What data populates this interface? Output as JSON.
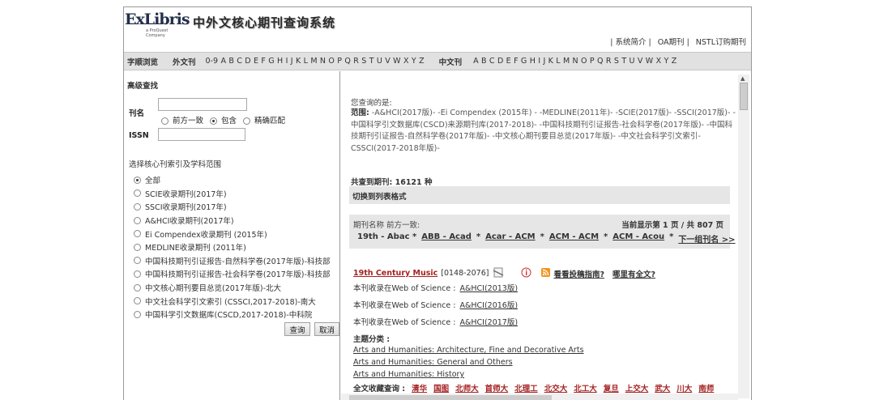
{
  "header": {
    "logo_text": "ExLibris",
    "logo_sub": "a ProQuest Company",
    "title": "中外文核心期刊查询系统",
    "links": [
      "| 系统简介 |",
      "OA期刊 |",
      "NSTL订购期刊"
    ]
  },
  "alpha_bar": {
    "browse_label": "字顺浏览",
    "foreign_label": "外文刊",
    "foreign_letters": [
      "0-9",
      "A",
      "B",
      "C",
      "D",
      "E",
      "F",
      "G",
      "H",
      "I",
      "J",
      "K",
      "L",
      "M",
      "N",
      "O",
      "P",
      "Q",
      "R",
      "S",
      "T",
      "U",
      "V",
      "W",
      "X",
      "Y",
      "Z"
    ],
    "chinese_label": "中文刊",
    "chinese_letters": [
      "A",
      "B",
      "C",
      "D",
      "E",
      "F",
      "G",
      "H",
      "I",
      "J",
      "K",
      "L",
      "M",
      "N",
      "O",
      "P",
      "Q",
      "R",
      "S",
      "T",
      "U",
      "V",
      "W",
      "X",
      "Y",
      "Z"
    ]
  },
  "search": {
    "section_title": "高级查找",
    "title_label": "刊名",
    "title_value": "",
    "match_options": [
      "前方一致",
      "包含",
      "精确匹配"
    ],
    "match_selected": 1,
    "issn_label": "ISSN",
    "issn_value": "",
    "index_title": "选择核心刊索引及学科范围",
    "index_options": [
      "全部",
      "SCIE收录期刊(2017年)",
      "SSCI收录期刊(2017年)",
      "A&HCI收录期刊(2017年)",
      "Ei Compendex收录期刊 (2015年)",
      "MEDLINE收录期刊 (2011年)",
      "中国科技期刊引证报告-自然科学卷(2017年版)-科技部",
      "中国科技期刊引证报告-社会科学卷(2017年版)-科技部",
      "中文核心期刊要目总览(2017年版)-北大",
      "中文社会科学引文索引 (CSSCI,2017-2018)-南大",
      "中国科学引文数据库(CSCD,2017-2018)-中科院"
    ],
    "index_selected": 0,
    "search_button": "查询",
    "cancel_button": "取消"
  },
  "results": {
    "query_label": "您查询的是:",
    "scope_label": "范围:",
    "scope_text": "-A&HCI(2017版)- -Ei Compendex (2015年) - -MEDLINE(2011年)- -SCIE(2017版)- -SSCI(2017版)- -中国科学引文数据库(CSCD)来源期刊库(2017-2018)- -中国科技期刊引证报告-社会科学卷(2017年版)- -中国科技期刊引证报告-自然科学卷(2017年版)- -中文核心期刊要目总览(2017年版)- -中文社会科学引文索引-CSSCI(2017-2018年版)-",
    "count_text": "共查到期刊: 16121 种",
    "switch_format": "切换到列表格式",
    "sort_label": "期刊名称 前方一致:",
    "page_info": "当前显示第 1 页 / 共 807 页",
    "groups": [
      "19th - Abac *",
      "ABB - Acad",
      "*",
      "Acar - ACM",
      "*",
      "ACM - ACM",
      "*",
      "ACM - Acou",
      "*",
      "下一组刊名 >>"
    ],
    "record": {
      "journal_title": "19th Century Music",
      "issn": "[0148-2076]",
      "guide_link": "看看投稿指南?",
      "fulltext_link": "哪里有全文?",
      "wos_label": "本刊收录在Web of Science :",
      "wos": [
        "A&HCI(2013版)",
        "A&HCI(2016版)",
        "A&HCI(2017版)"
      ],
      "subject_label": "主题分类 :",
      "subjects": [
        "Arts and Humanities: Architecture, Fine and Decorative Arts",
        "Arts and Humanities: General and Others",
        "Arts and Humanities: History"
      ],
      "fulltext_label": "全文收藏查询 :",
      "libraries": [
        "清华",
        "国图",
        "北师大",
        "首师大",
        "北理工",
        "北交大",
        "北工大",
        "复旦",
        "上交大",
        "武大",
        "川大",
        "南师"
      ]
    }
  }
}
